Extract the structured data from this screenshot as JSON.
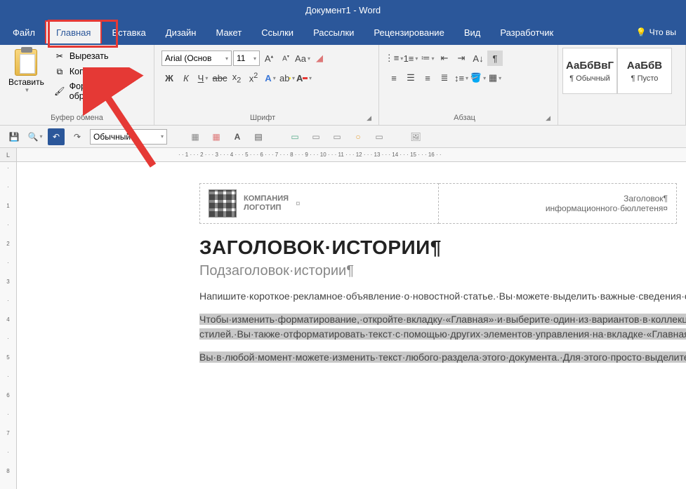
{
  "title_bar": {
    "title": "Документ1 - Word"
  },
  "menu": {
    "file": "Файл",
    "home": "Главная",
    "insert": "Вставка",
    "design": "Дизайн",
    "layout": "Макет",
    "references": "Ссылки",
    "mailings": "Рассылки",
    "review": "Рецензирование",
    "view": "Вид",
    "developer": "Разработчик",
    "tell_me": "Что вы"
  },
  "ribbon": {
    "clipboard": {
      "label": "Буфер обмена",
      "paste": "Вставить",
      "cut": "Вырезать",
      "copy": "Копировать",
      "format_painter": "Формат по образцу"
    },
    "font": {
      "label": "Шрифт",
      "name": "Arial (Основ",
      "size": "11"
    },
    "paragraph": {
      "label": "Абзац"
    },
    "styles": {
      "preview1": "АаБбВвГ",
      "name1": "¶ Обычный",
      "preview2": "АаБбВ",
      "name2": "¶ Пусто"
    }
  },
  "qat": {
    "style": "Обычный"
  },
  "ruler": {
    "corner": "L",
    "horizontal": "· · 1 · · · 2 · · · 3 · · · 4 · · · 5 · · · 6 · · · 7 · · · 8 · · · 9 · · · 10 · · · 11 · · · 12 · · · 13 · · · 14 · · · 15 · · · 16 · ·"
  },
  "document": {
    "logo_line1": "КОМПАНИЯ",
    "logo_line2": "ЛОГОТИП",
    "header_right_l1": "Заголовок¶",
    "header_right_l2": "информационного·бюллетеня¤",
    "title": "ЗАГОЛОВОК·ИСТОРИИ¶",
    "subtitle": "Подзаголовок·истории¶",
    "para1": "Напишите·короткое·рекламное·объявление·о·новостной·статье.·Вы·можете·выделить·важные·сведения·о·своей·компании,·о·которых·расскажете·ниже.¶",
    "para2": "Чтобы·изменить·форматирование,·откройте·вкладку·«Главная»·и·выберите·один·из·вариантов·в·коллекции·экспресс-стилей.·Вы·также·отформатировать·текст·с·помощью·других·элементов·управления·на·вкладке·«Главная».¶",
    "para3": "Вы·в·любой·момент·можете·изменить·текст·любого·раздела·этого·документа.·Для·этого·просто·выделите·текст·и·начните·печатать.·Этот·шаблон·предварительно·подготовлен,·поэтому·для·новой·введенной·информации·форматирование·сохраняется.¶"
  }
}
